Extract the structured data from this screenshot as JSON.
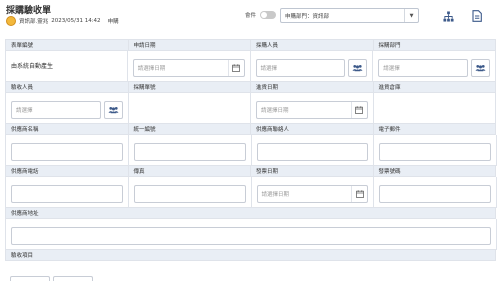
{
  "header": {
    "title": "採購驗收單",
    "author": "資訊部.靈兆",
    "datetime": "2023/05/31 14:42",
    "status": "申購",
    "toggle_label": "會件",
    "dept_select": "申購部門：資訊部"
  },
  "form": {
    "row1": {
      "labels": [
        "表單編號",
        "申請日期",
        "採購人員",
        "採購部門"
      ],
      "form_no": "由系統自動產生",
      "date_placeholder": "請選擇日期",
      "buyer_placeholder": "請選擇",
      "dept_placeholder": "請選擇"
    },
    "row2": {
      "labels": [
        "驗收人員",
        "採購單號",
        "進貨日期",
        "進貨倉庫"
      ],
      "inspector_placeholder": "請選擇",
      "date_placeholder": "請選擇日期"
    },
    "row3": {
      "labels": [
        "供應商名稱",
        "統一編號",
        "供應商聯絡人",
        "電子郵件"
      ]
    },
    "row4": {
      "labels": [
        "供應商電話",
        "傳真",
        "發票日期",
        "發票號碼"
      ],
      "date_placeholder": "請選擇日期"
    },
    "row5": {
      "label": "供應商地址"
    },
    "row6": {
      "label": "驗收項目"
    }
  },
  "icons": {
    "avatar": "avatar",
    "org_chart": "org-chart-icon",
    "document": "document-icon",
    "calendar": "calendar-icon",
    "people": "people-icon"
  },
  "colors": {
    "accent": "#3d5a8a",
    "label_bg": "#e9eef5",
    "avatar": "#f3b83b"
  }
}
